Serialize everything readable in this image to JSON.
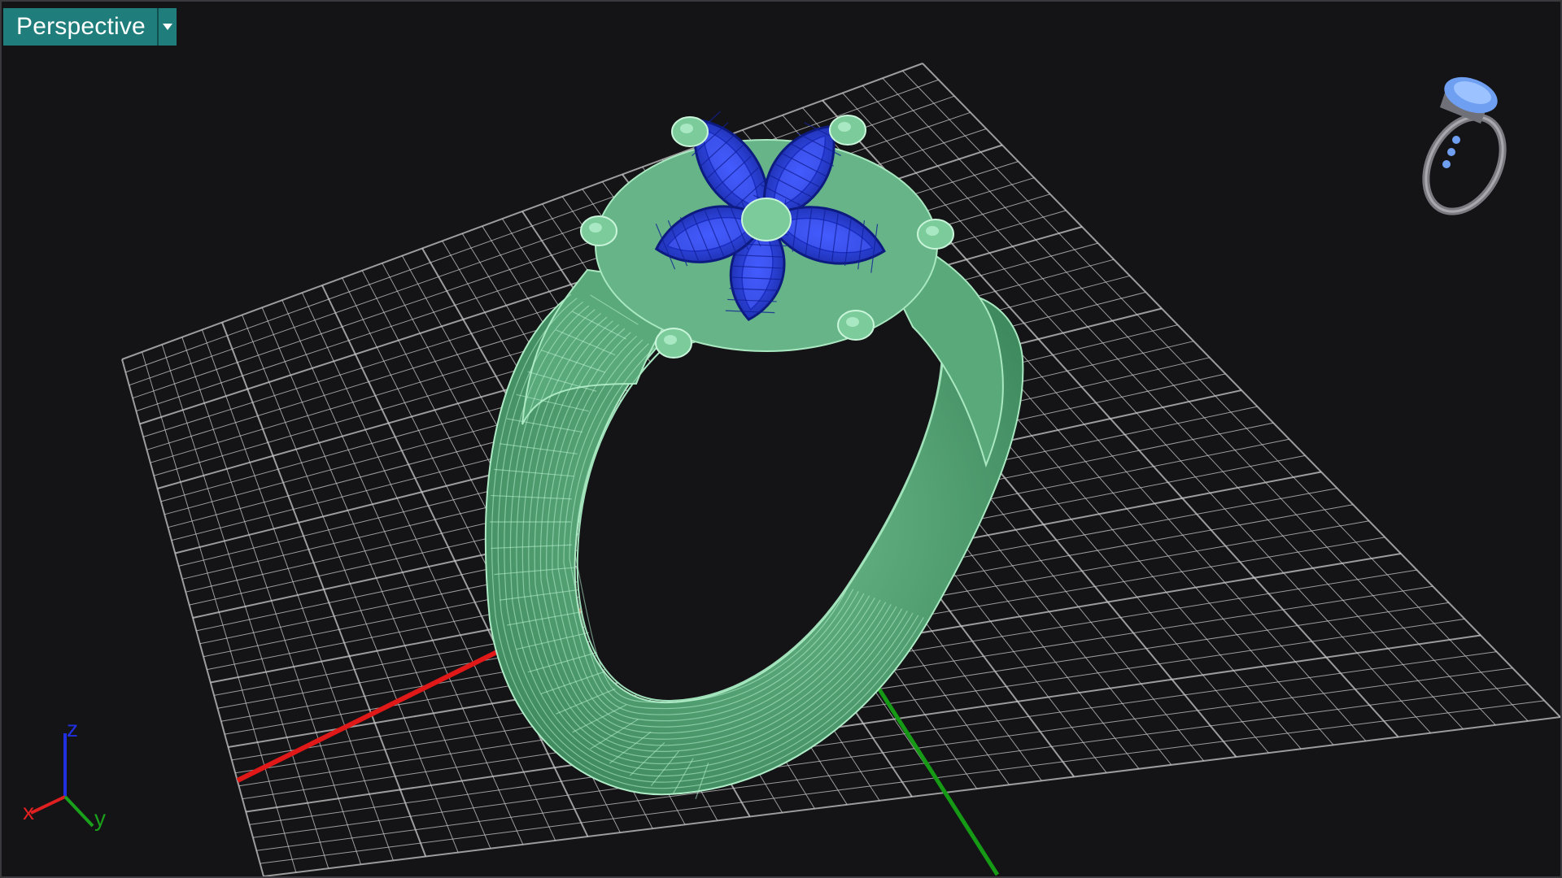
{
  "viewport": {
    "title": "Perspective",
    "menu_icon": "chevron-down-icon"
  },
  "axes_widget": {
    "x_label": "x",
    "y_label": "y",
    "z_label": "z",
    "x_color": "#e02020",
    "y_color": "#1aa01a",
    "z_color": "#2030e0"
  },
  "colors": {
    "background": "#141417",
    "grid": "#c9c9c9",
    "ring_wireframe": "#6fc08f",
    "gemstones": "#2a3fd6",
    "tab_accent": "#1f7d7b"
  }
}
